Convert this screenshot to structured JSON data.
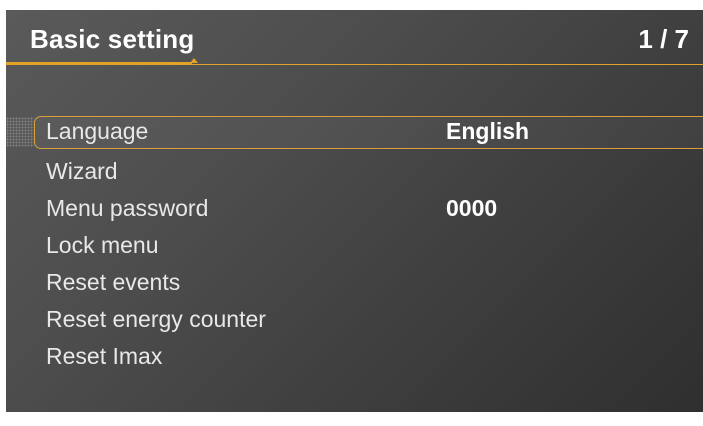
{
  "header": {
    "title": "Basic setting",
    "page": "1 / 7"
  },
  "colors": {
    "accent": "#e0a325",
    "background": "#4a4a4a",
    "text": "#e8e8e8"
  },
  "menu": {
    "items": [
      {
        "label": "Language",
        "value": "English",
        "selected": true
      },
      {
        "label": "Wizard",
        "value": ""
      },
      {
        "label": "Menu password",
        "value": "0000"
      },
      {
        "label": "Lock menu",
        "value": ""
      },
      {
        "label": "Reset events",
        "value": ""
      },
      {
        "label": "Reset energy counter",
        "value": ""
      },
      {
        "label": "Reset Imax",
        "value": ""
      }
    ]
  }
}
